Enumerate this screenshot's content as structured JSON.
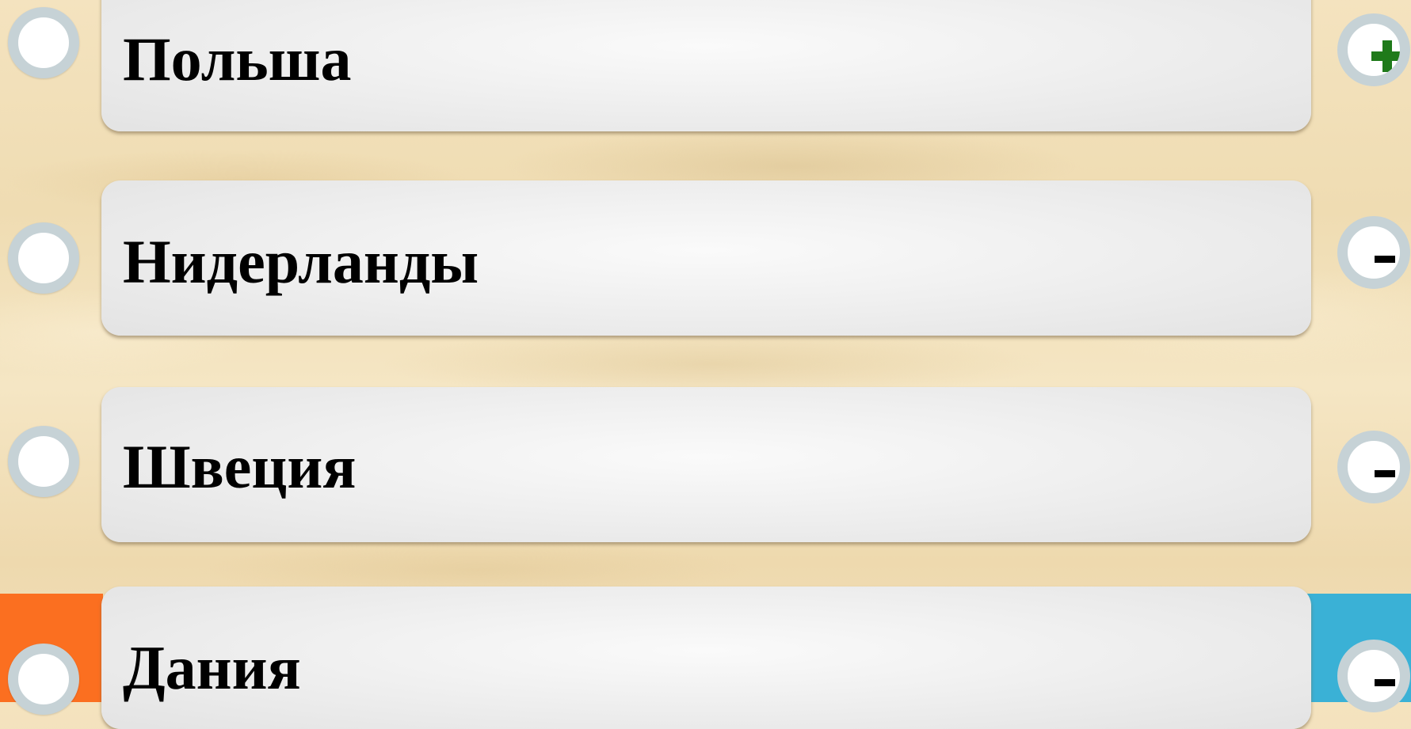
{
  "answers": [
    {
      "label": "Польша",
      "score_icon": "plus-icon"
    },
    {
      "label": "Нидерланды",
      "score_icon": "minus-icon"
    },
    {
      "label": "Швеция",
      "score_icon": "minus-icon"
    },
    {
      "label": "Дания",
      "score_icon": "minus-icon"
    }
  ],
  "colors": {
    "left_panel": "#fb6f20",
    "right_panel": "#3ab1d6",
    "plus": "#1f7a1a",
    "minus": "#000000",
    "radio_ring": "#c6d2d6"
  }
}
